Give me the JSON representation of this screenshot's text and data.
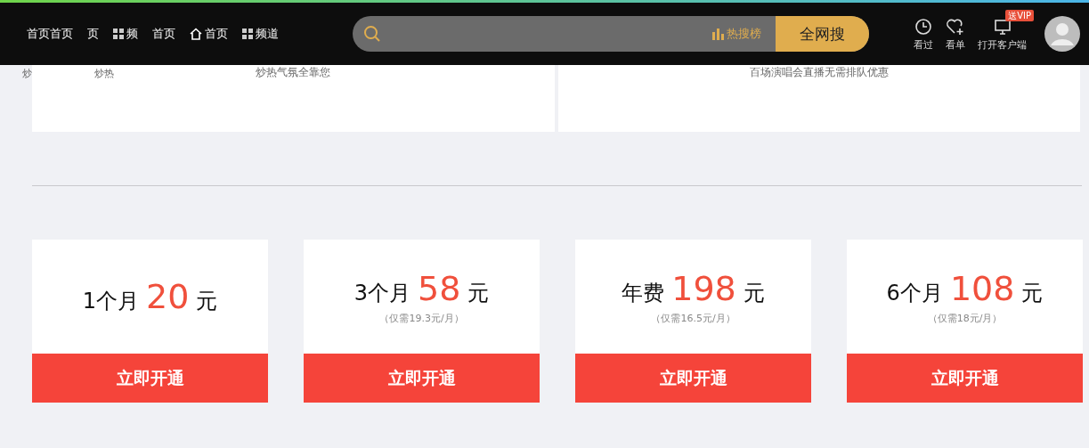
{
  "header": {
    "nav_items": [
      {
        "label": "首页首页",
        "kind": "text"
      },
      {
        "label": "页",
        "kind": "text"
      },
      {
        "label": "频",
        "kind": "grid"
      },
      {
        "label": "首页",
        "kind": "text"
      },
      {
        "label": "首页",
        "kind": "home"
      },
      {
        "label": "频道",
        "kind": "grid"
      }
    ],
    "search": {
      "hot_label": "热搜榜",
      "button": "全网搜"
    },
    "actions": [
      {
        "label": "看过",
        "kind": "history"
      },
      {
        "label": "看单",
        "kind": "watchlist"
      },
      {
        "label": "打开客户端",
        "kind": "client",
        "badge": "送VIP"
      }
    ]
  },
  "top_fragments": [
    "炒",
    "炒热"
  ],
  "promo_cards": [
    {
      "subtitle": "炒热气氛全靠您"
    },
    {
      "subtitle": "百场演唱会直播无需排队优惠"
    }
  ],
  "plans": [
    {
      "period": "1个月",
      "price": "20",
      "unit": "元",
      "button": "立即开通"
    },
    {
      "period": "3个月",
      "price": "58",
      "unit": "元",
      "note": "（仅需19.3元/月）",
      "button": "立即开通"
    },
    {
      "period": "年费",
      "price": "198",
      "unit": "元",
      "note": "（仅需16.5元/月）",
      "button": "立即开通"
    },
    {
      "period": "6个月",
      "price": "108",
      "unit": "元",
      "note": "（仅需18元/月）",
      "button": "立即开通"
    }
  ]
}
